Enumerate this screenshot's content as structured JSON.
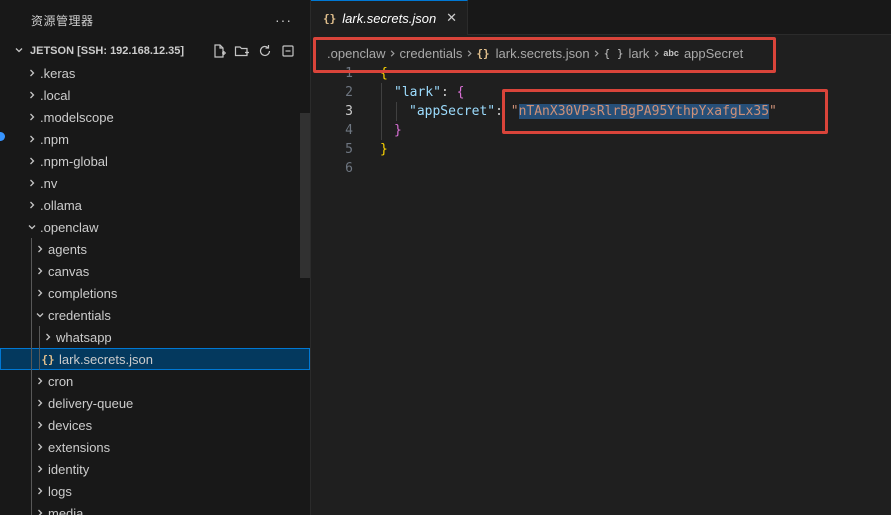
{
  "explorer": {
    "title": "资源管理器",
    "more": "···",
    "workspace": "JETSON [SSH: 192.168.12.35]",
    "actions": [
      "new-file-icon",
      "new-folder-icon",
      "refresh-icon",
      "collapse-all-icon"
    ]
  },
  "tree": [
    {
      "label": ".keras",
      "depth": 0,
      "kind": "folder",
      "open": false
    },
    {
      "label": ".local",
      "depth": 0,
      "kind": "folder",
      "open": false
    },
    {
      "label": ".modelscope",
      "depth": 0,
      "kind": "folder",
      "open": false
    },
    {
      "label": ".npm",
      "depth": 0,
      "kind": "folder",
      "open": false
    },
    {
      "label": ".npm-global",
      "depth": 0,
      "kind": "folder",
      "open": false
    },
    {
      "label": ".nv",
      "depth": 0,
      "kind": "folder",
      "open": false
    },
    {
      "label": ".ollama",
      "depth": 0,
      "kind": "folder",
      "open": false
    },
    {
      "label": ".openclaw",
      "depth": 0,
      "kind": "folder",
      "open": true
    },
    {
      "label": "agents",
      "depth": 1,
      "kind": "folder",
      "open": false
    },
    {
      "label": "canvas",
      "depth": 1,
      "kind": "folder",
      "open": false
    },
    {
      "label": "completions",
      "depth": 1,
      "kind": "folder",
      "open": false
    },
    {
      "label": "credentials",
      "depth": 1,
      "kind": "folder",
      "open": true
    },
    {
      "label": "whatsapp",
      "depth": 2,
      "kind": "folder",
      "open": false
    },
    {
      "label": "lark.secrets.json",
      "depth": 2,
      "kind": "json",
      "selected": true
    },
    {
      "label": "cron",
      "depth": 1,
      "kind": "folder",
      "open": false
    },
    {
      "label": "delivery-queue",
      "depth": 1,
      "kind": "folder",
      "open": false
    },
    {
      "label": "devices",
      "depth": 1,
      "kind": "folder",
      "open": false
    },
    {
      "label": "extensions",
      "depth": 1,
      "kind": "folder",
      "open": false
    },
    {
      "label": "identity",
      "depth": 1,
      "kind": "folder",
      "open": false
    },
    {
      "label": "logs",
      "depth": 1,
      "kind": "folder",
      "open": false
    },
    {
      "label": "media",
      "depth": 1,
      "kind": "folder",
      "open": false
    }
  ],
  "editor": {
    "tab": {
      "icon": "{}",
      "label": "lark.secrets.json",
      "close": "✕"
    },
    "breadcrumbs": [
      ".openclaw",
      "credentials",
      "lark.secrets.json",
      "lark",
      "appSecret"
    ],
    "crumb_icons": {
      "json": "{}",
      "object": "{ }",
      "string": "abc"
    },
    "lines": [
      "1",
      "2",
      "3",
      "4",
      "5",
      "6"
    ],
    "code": {
      "open_brace": "{",
      "key_lark": "\"lark\"",
      "colon": ":",
      "inner_open": "{",
      "key_app": "\"appSecret\"",
      "quote_open": "\"",
      "secret_value": "nTAnX30VPsRlrBgPA95YthpYxafgLx35",
      "quote_close": "\"",
      "inner_close": "}",
      "close_brace": "}"
    }
  },
  "colors": {
    "annotation": "#d9443a",
    "selection": "#264f78",
    "accent": "#0078d4"
  }
}
